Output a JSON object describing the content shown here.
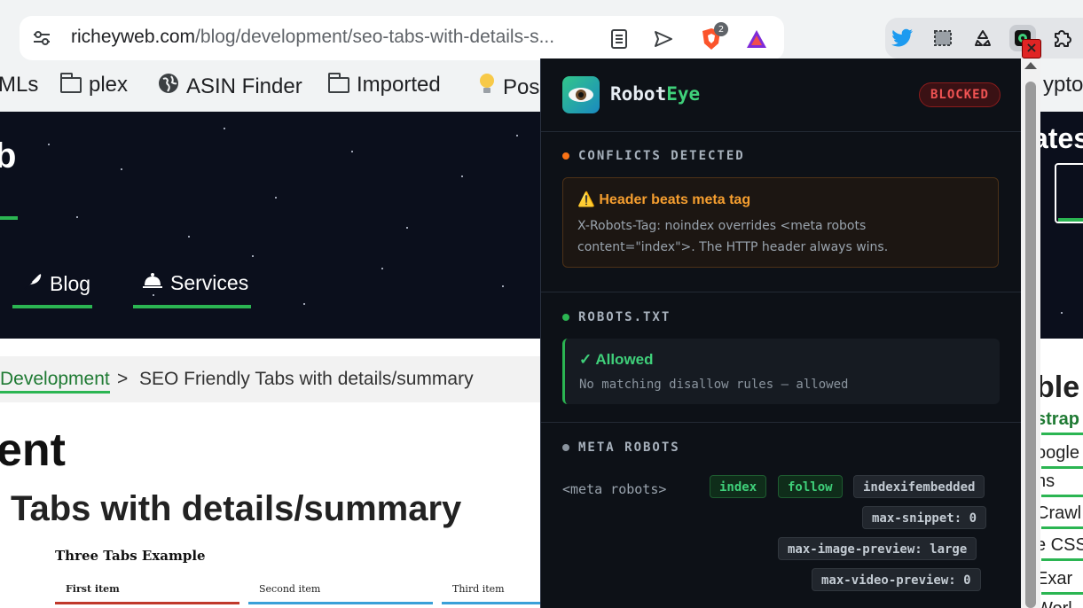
{
  "browser": {
    "url_domain": "richeyweb.com",
    "url_path": "/blog/development/seo-tabs-with-details-s...",
    "brave_badge_count": "2",
    "bookmarks": [
      {
        "label": "MLs",
        "icon": "none"
      },
      {
        "label": "plex",
        "icon": "folder-icon"
      },
      {
        "label": "ASIN Finder",
        "icon": "globe-icon"
      },
      {
        "label": "Imported",
        "icon": "folder-icon"
      },
      {
        "label": "Pos",
        "icon": "lightbulb-icon"
      },
      {
        "label": "ypto",
        "icon": "none"
      }
    ],
    "close_label": "×"
  },
  "page": {
    "site_logo": "b",
    "nav": [
      {
        "label": "Blog",
        "icon": "feather-icon"
      },
      {
        "label": "Services",
        "icon": "bell-icon"
      }
    ],
    "right_title": "ates",
    "breadcrumb": {
      "link": "Development",
      "separator": ">",
      "current": "SEO Friendly Tabs with details/summary"
    },
    "heading_partial": "ent",
    "subheading": "Tabs with details/summary",
    "demo": {
      "title": "Three Tabs Example",
      "tabs": [
        {
          "label": "First item",
          "color": "#c0392b"
        },
        {
          "label": "Second item",
          "color": "#3aa0d8"
        },
        {
          "label": "Third item",
          "color": "#3aa0d8"
        }
      ]
    },
    "right_column": {
      "heading": "ble",
      "items": [
        "strap",
        "oogle",
        "ns",
        "Crawl",
        "e CSS",
        "Exar",
        "Worl"
      ]
    }
  },
  "popup": {
    "brand_prefix": "Robot",
    "brand_suffix": "Eye",
    "status_badge": "BLOCKED",
    "conflicts": {
      "title": "CONFLICTS DETECTED",
      "dot_color": "#f97316",
      "card_title": "⚠️ Header beats meta tag",
      "card_body": "X-Robots-Tag: noindex overrides <meta robots content=\"index\">. The HTTP header always wins."
    },
    "robots_txt": {
      "title": "ROBOTS.TXT",
      "dot_color": "#2bb552",
      "status": "✓ Allowed",
      "detail": "No matching disallow rules — allowed"
    },
    "meta_robots": {
      "title": "META ROBOTS",
      "dot_color": "#8a949e",
      "label": "<meta robots>",
      "tags": [
        {
          "text": "index",
          "style": "green"
        },
        {
          "text": "follow",
          "style": "green"
        },
        {
          "text": "indexifembedded",
          "style": "grey"
        },
        {
          "text": "max-snippet: 0",
          "style": "grey"
        },
        {
          "text": "max-image-preview: large",
          "style": "grey"
        },
        {
          "text": "max-video-preview: 0",
          "style": "grey"
        }
      ]
    }
  }
}
